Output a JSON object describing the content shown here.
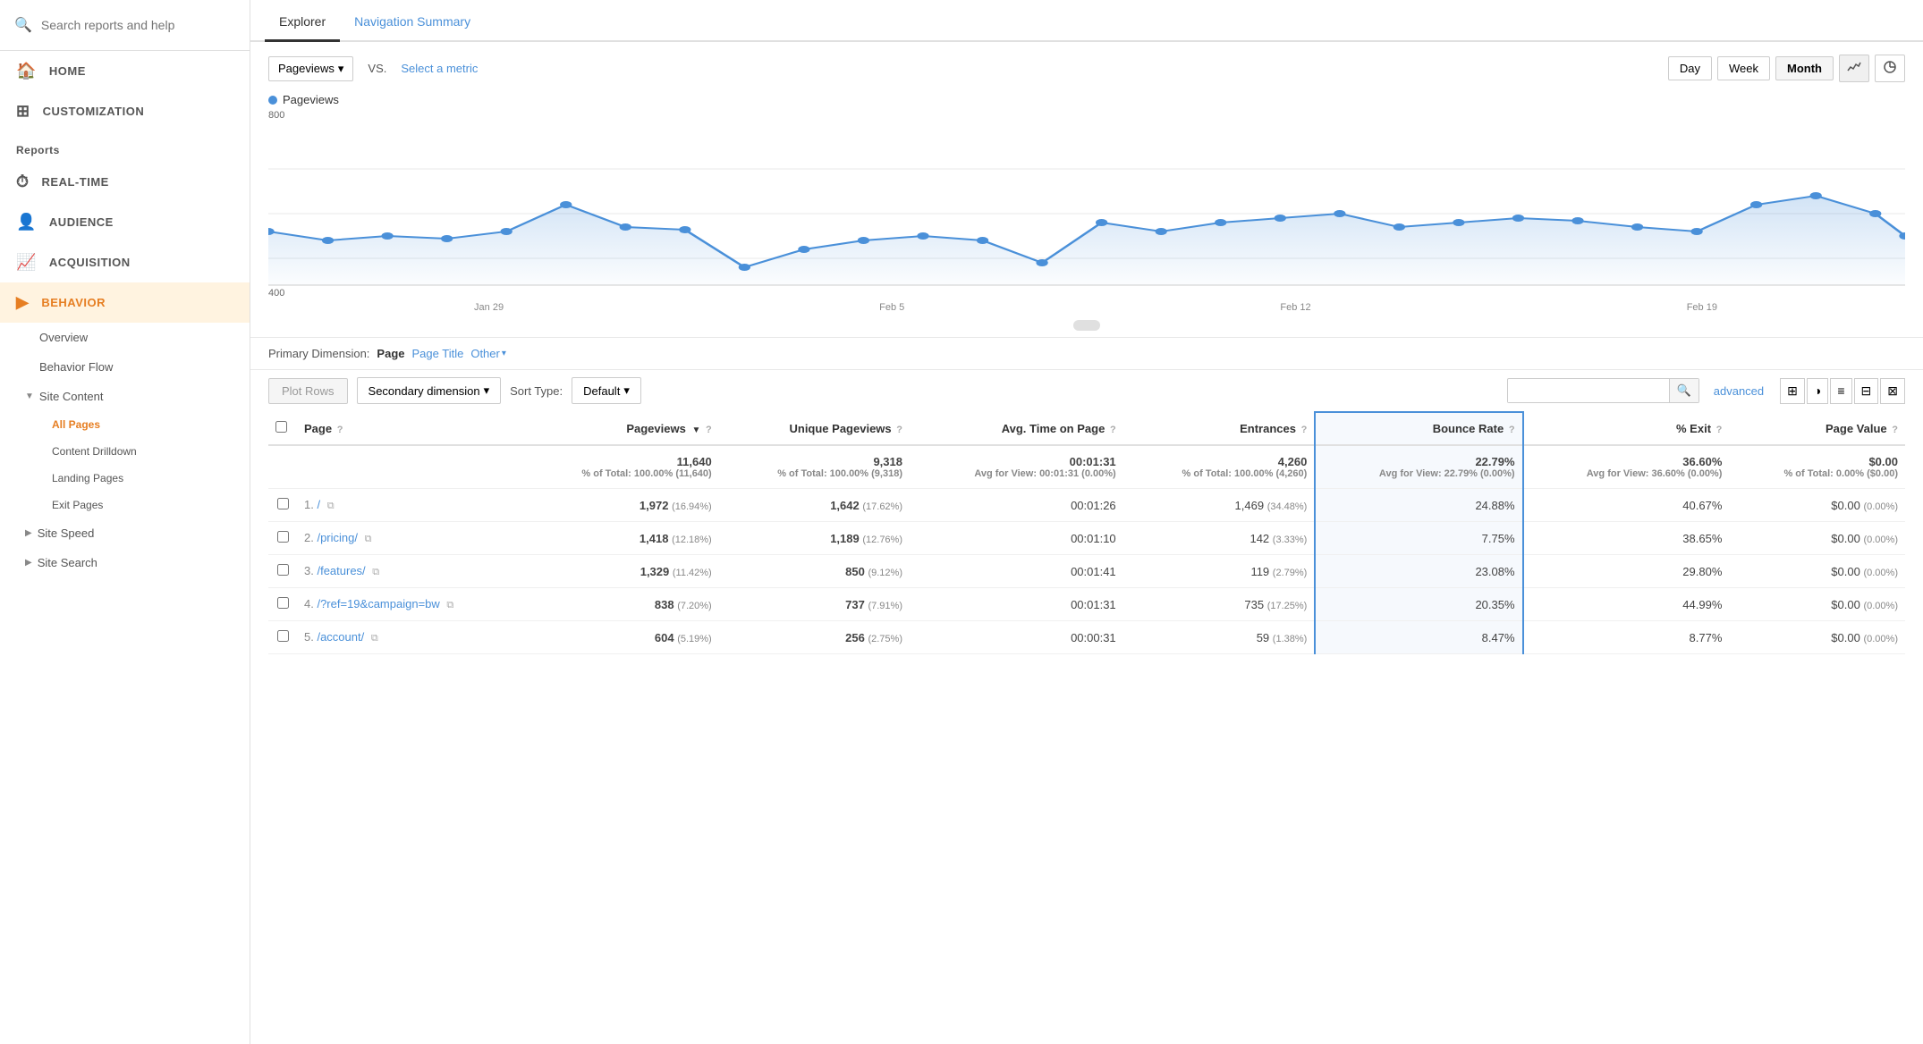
{
  "sidebar": {
    "search_placeholder": "Search reports and help",
    "nav_items": [
      {
        "id": "home",
        "label": "HOME",
        "icon": "🏠"
      },
      {
        "id": "customization",
        "label": "CUSTOMIZATION",
        "icon": "⊞"
      }
    ],
    "reports_label": "Reports",
    "report_sections": [
      {
        "id": "realtime",
        "label": "REAL-TIME",
        "icon": "⏱"
      },
      {
        "id": "audience",
        "label": "AUDIENCE",
        "icon": "👤"
      },
      {
        "id": "acquisition",
        "label": "ACQUISITION",
        "icon": "📈"
      },
      {
        "id": "behavior",
        "label": "BEHAVIOR",
        "icon": "▶",
        "active": true
      }
    ],
    "behavior_sub": [
      {
        "id": "overview",
        "label": "Overview",
        "active": false
      },
      {
        "id": "behavior-flow",
        "label": "Behavior Flow",
        "active": false
      }
    ],
    "site_content": {
      "label": "Site Content",
      "items": [
        {
          "id": "all-pages",
          "label": "All Pages",
          "active": true
        },
        {
          "id": "content-drilldown",
          "label": "Content Drilldown",
          "active": false
        },
        {
          "id": "landing-pages",
          "label": "Landing Pages",
          "active": false
        },
        {
          "id": "exit-pages",
          "label": "Exit Pages",
          "active": false
        }
      ]
    },
    "site_speed_label": "Site Speed",
    "site_search_label": "Site Search"
  },
  "tabs": [
    {
      "id": "explorer",
      "label": "Explorer",
      "active": true
    },
    {
      "id": "nav-summary",
      "label": "Navigation Summary",
      "active": false
    }
  ],
  "chart": {
    "metric_label": "Pageviews",
    "vs_label": "VS.",
    "select_metric_label": "Select a metric",
    "legend_label": "Pageviews",
    "legend_color": "#4a90d9",
    "y_label": "800",
    "y_label2": "400",
    "x_labels": [
      "Jan 29",
      "Feb 5",
      "Feb 12",
      "Feb 19"
    ],
    "time_buttons": [
      "Day",
      "Week",
      "Month"
    ],
    "active_time": "Month"
  },
  "primary_dim": {
    "label": "Primary Dimension:",
    "options": [
      {
        "id": "page",
        "label": "Page",
        "active": true
      },
      {
        "id": "page-title",
        "label": "Page Title",
        "active": false
      },
      {
        "id": "other",
        "label": "Other",
        "active": false
      }
    ]
  },
  "table_controls": {
    "plot_rows_label": "Plot Rows",
    "secondary_dim_label": "Secondary dimension",
    "sort_type_label": "Sort Type:",
    "default_label": "Default",
    "advanced_label": "advanced"
  },
  "table": {
    "headers": [
      {
        "id": "checkbox",
        "label": ""
      },
      {
        "id": "page",
        "label": "Page",
        "help": true
      },
      {
        "id": "pageviews",
        "label": "Pageviews",
        "help": true,
        "sorted": true
      },
      {
        "id": "unique-pageviews",
        "label": "Unique Pageviews",
        "help": true
      },
      {
        "id": "avg-time",
        "label": "Avg. Time on Page",
        "help": true
      },
      {
        "id": "entrances",
        "label": "Entrances",
        "help": true
      },
      {
        "id": "bounce-rate",
        "label": "Bounce Rate",
        "help": true,
        "highlight": true
      },
      {
        "id": "exit",
        "label": "% Exit",
        "help": true
      },
      {
        "id": "page-value",
        "label": "Page Value",
        "help": true
      }
    ],
    "summary": {
      "pageviews": "11,640",
      "pageviews_sub": "% of Total: 100.00% (11,640)",
      "unique_pageviews": "9,318",
      "unique_sub": "% of Total: 100.00% (9,318)",
      "avg_time": "00:01:31",
      "avg_time_sub": "Avg for View: 00:01:31 (0.00%)",
      "entrances": "4,260",
      "entrances_sub": "% of Total: 100.00% (4,260)",
      "bounce_rate": "22.79%",
      "bounce_sub": "Avg for View: 22.79% (0.00%)",
      "exit": "36.60%",
      "exit_sub": "Avg for View: 36.60% (0.00%)",
      "page_value": "$0.00",
      "page_value_sub": "% of Total: 0.00% ($0.00)"
    },
    "rows": [
      {
        "num": "1.",
        "page": "/",
        "pageviews": "1,972",
        "pageviews_pct": "(16.94%)",
        "unique_pageviews": "1,642",
        "unique_pct": "(17.62%)",
        "avg_time": "00:01:26",
        "entrances": "1,469",
        "entrances_pct": "(34.48%)",
        "bounce_rate": "24.88%",
        "exit": "40.67%",
        "page_value": "$0.00",
        "page_value_pct": "(0.00%)"
      },
      {
        "num": "2.",
        "page": "/pricing/",
        "pageviews": "1,418",
        "pageviews_pct": "(12.18%)",
        "unique_pageviews": "1,189",
        "unique_pct": "(12.76%)",
        "avg_time": "00:01:10",
        "entrances": "142",
        "entrances_pct": "(3.33%)",
        "bounce_rate": "7.75%",
        "exit": "38.65%",
        "page_value": "$0.00",
        "page_value_pct": "(0.00%)"
      },
      {
        "num": "3.",
        "page": "/features/",
        "pageviews": "1,329",
        "pageviews_pct": "(11.42%)",
        "unique_pageviews": "850",
        "unique_pct": "(9.12%)",
        "avg_time": "00:01:41",
        "entrances": "119",
        "entrances_pct": "(2.79%)",
        "bounce_rate": "23.08%",
        "exit": "29.80%",
        "page_value": "$0.00",
        "page_value_pct": "(0.00%)"
      },
      {
        "num": "4.",
        "page": "/?ref=19&campaign=bw",
        "pageviews": "838",
        "pageviews_pct": "(7.20%)",
        "unique_pageviews": "737",
        "unique_pct": "(7.91%)",
        "avg_time": "00:01:31",
        "entrances": "735",
        "entrances_pct": "(17.25%)",
        "bounce_rate": "20.35%",
        "exit": "44.99%",
        "page_value": "$0.00",
        "page_value_pct": "(0.00%)"
      },
      {
        "num": "5.",
        "page": "/account/",
        "pageviews": "604",
        "pageviews_pct": "(5.19%)",
        "unique_pageviews": "256",
        "unique_pct": "(2.75%)",
        "avg_time": "00:00:31",
        "entrances": "59",
        "entrances_pct": "(1.38%)",
        "bounce_rate": "8.47%",
        "exit": "8.77%",
        "page_value": "$0.00",
        "page_value_pct": "(0.00%)"
      }
    ]
  }
}
